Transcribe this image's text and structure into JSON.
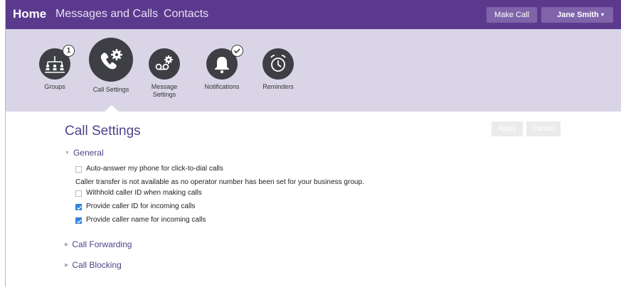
{
  "header": {
    "brand": "Home",
    "nav": [
      "Messages and Calls",
      "Contacts"
    ],
    "make_call": "Make Call",
    "user_name": "Jane Smith",
    "user_caret": "▾"
  },
  "icons": [
    {
      "label": "Groups",
      "icon": "groups-icon",
      "badge": "1"
    },
    {
      "label": "Call Settings",
      "icon": "call-settings-icon",
      "selected": true
    },
    {
      "label_line1": "Message",
      "label_line2": "Settings",
      "icon": "message-settings-icon"
    },
    {
      "label": "Notifications",
      "icon": "notifications-icon",
      "badge_icon": "check-icon"
    },
    {
      "label": "Reminders",
      "icon": "alarm-clock-icon"
    }
  ],
  "page": {
    "title": "Call Settings",
    "apply": "Apply",
    "cancel": "Cancel"
  },
  "general": {
    "title": "General",
    "auto_answer": {
      "label": "Auto-answer my phone for click-to-dial calls",
      "checked": false
    },
    "transfer_note": "Caller transfer is not available as no operator number has been set for your business group.",
    "withhold": {
      "label": "Withhold caller ID when making calls",
      "checked": false
    },
    "provide_id": {
      "label": "Provide caller ID for incoming calls",
      "checked": true
    },
    "provide_name": {
      "label": "Provide caller name for incoming calls",
      "checked": true
    }
  },
  "call_forwarding": {
    "title": "Call Forwarding"
  },
  "call_blocking": {
    "title": "Call Blocking"
  },
  "colors": {
    "brand_purple": "#5b3a8e",
    "icon_dark": "#3d3f44",
    "accent_text": "#51428a",
    "checkbox_blue": "#2f86e0"
  }
}
